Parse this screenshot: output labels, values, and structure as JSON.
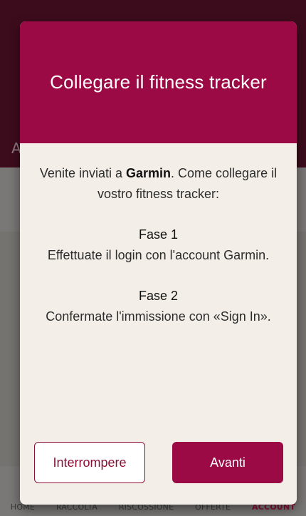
{
  "background": {
    "header_text": "A",
    "nav_items": [
      "HOME",
      "RACCOLTA",
      "RISCOSSIONE",
      "OFFERTE",
      "ACCOUNT"
    ]
  },
  "modal": {
    "title": "Collegare il fitness tracker",
    "intro_prefix": "Venite inviati a ",
    "intro_brand": "Garmin",
    "intro_suffix": ". Come collegare il vostro fitness tracker:",
    "steps": [
      {
        "title": "Fase 1",
        "text": "Effettuate il login con l'account Garmin."
      },
      {
        "title": "Fase 2",
        "text": "Confermate l'immissione con «Sign In»."
      }
    ],
    "cancel_label": "Interrompere",
    "next_label": "Avanti"
  },
  "colors": {
    "brand": "#9c0a45",
    "modal_background": "#f3efe8"
  }
}
